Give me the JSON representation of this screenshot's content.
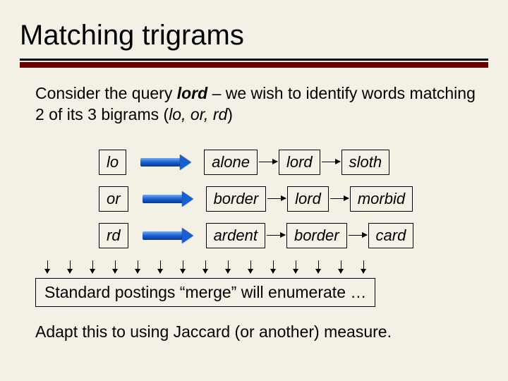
{
  "title": "Matching trigrams",
  "intro_html": "Consider the query <b><i>lord</i></b> – we wish to identify words matching 2 of its 3 bigrams (<i>lo, or, rd</i>)",
  "rows": [
    {
      "bigram": "lo",
      "words": [
        "alone",
        "lord",
        "sloth"
      ]
    },
    {
      "bigram": "or",
      "words": [
        "border",
        "lord",
        "morbid"
      ]
    },
    {
      "bigram": "rd",
      "words": [
        "ardent",
        "border",
        "card"
      ]
    }
  ],
  "merge_line": "Standard postings “merge” will enumerate …",
  "adapt_line": "Adapt this to using Jaccard (or another) measure."
}
